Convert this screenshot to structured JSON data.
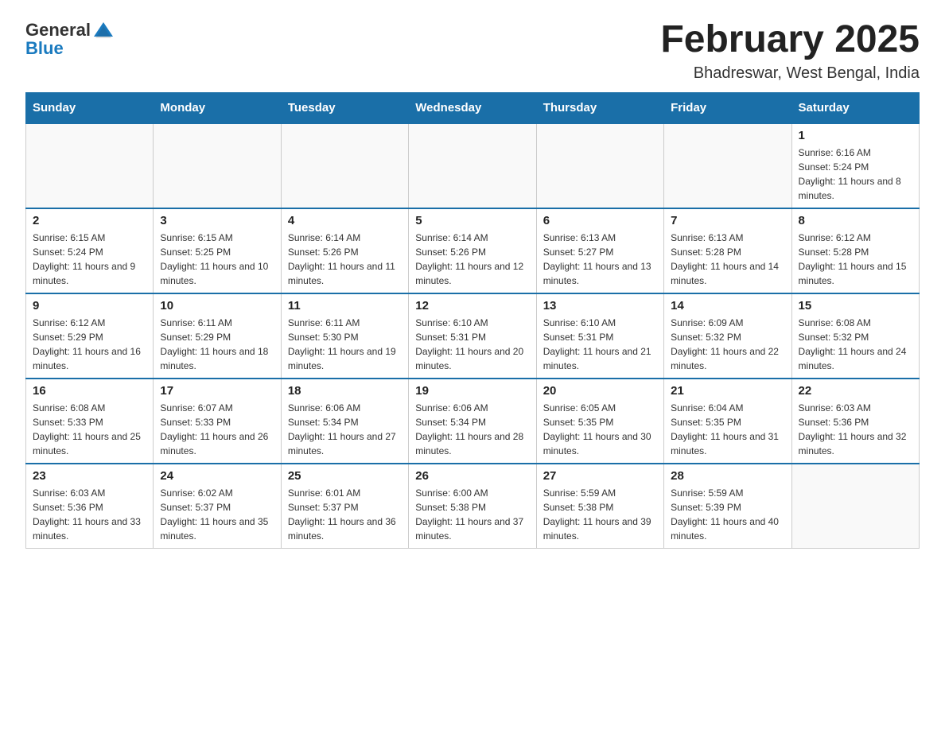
{
  "header": {
    "logo_general": "General",
    "logo_blue": "Blue",
    "title": "February 2025",
    "subtitle": "Bhadreswar, West Bengal, India"
  },
  "days_of_week": [
    "Sunday",
    "Monday",
    "Tuesday",
    "Wednesday",
    "Thursday",
    "Friday",
    "Saturday"
  ],
  "weeks": [
    {
      "days": [
        {
          "date": "",
          "info": ""
        },
        {
          "date": "",
          "info": ""
        },
        {
          "date": "",
          "info": ""
        },
        {
          "date": "",
          "info": ""
        },
        {
          "date": "",
          "info": ""
        },
        {
          "date": "",
          "info": ""
        },
        {
          "date": "1",
          "info": "Sunrise: 6:16 AM\nSunset: 5:24 PM\nDaylight: 11 hours and 8 minutes."
        }
      ]
    },
    {
      "days": [
        {
          "date": "2",
          "info": "Sunrise: 6:15 AM\nSunset: 5:24 PM\nDaylight: 11 hours and 9 minutes."
        },
        {
          "date": "3",
          "info": "Sunrise: 6:15 AM\nSunset: 5:25 PM\nDaylight: 11 hours and 10 minutes."
        },
        {
          "date": "4",
          "info": "Sunrise: 6:14 AM\nSunset: 5:26 PM\nDaylight: 11 hours and 11 minutes."
        },
        {
          "date": "5",
          "info": "Sunrise: 6:14 AM\nSunset: 5:26 PM\nDaylight: 11 hours and 12 minutes."
        },
        {
          "date": "6",
          "info": "Sunrise: 6:13 AM\nSunset: 5:27 PM\nDaylight: 11 hours and 13 minutes."
        },
        {
          "date": "7",
          "info": "Sunrise: 6:13 AM\nSunset: 5:28 PM\nDaylight: 11 hours and 14 minutes."
        },
        {
          "date": "8",
          "info": "Sunrise: 6:12 AM\nSunset: 5:28 PM\nDaylight: 11 hours and 15 minutes."
        }
      ]
    },
    {
      "days": [
        {
          "date": "9",
          "info": "Sunrise: 6:12 AM\nSunset: 5:29 PM\nDaylight: 11 hours and 16 minutes."
        },
        {
          "date": "10",
          "info": "Sunrise: 6:11 AM\nSunset: 5:29 PM\nDaylight: 11 hours and 18 minutes."
        },
        {
          "date": "11",
          "info": "Sunrise: 6:11 AM\nSunset: 5:30 PM\nDaylight: 11 hours and 19 minutes."
        },
        {
          "date": "12",
          "info": "Sunrise: 6:10 AM\nSunset: 5:31 PM\nDaylight: 11 hours and 20 minutes."
        },
        {
          "date": "13",
          "info": "Sunrise: 6:10 AM\nSunset: 5:31 PM\nDaylight: 11 hours and 21 minutes."
        },
        {
          "date": "14",
          "info": "Sunrise: 6:09 AM\nSunset: 5:32 PM\nDaylight: 11 hours and 22 minutes."
        },
        {
          "date": "15",
          "info": "Sunrise: 6:08 AM\nSunset: 5:32 PM\nDaylight: 11 hours and 24 minutes."
        }
      ]
    },
    {
      "days": [
        {
          "date": "16",
          "info": "Sunrise: 6:08 AM\nSunset: 5:33 PM\nDaylight: 11 hours and 25 minutes."
        },
        {
          "date": "17",
          "info": "Sunrise: 6:07 AM\nSunset: 5:33 PM\nDaylight: 11 hours and 26 minutes."
        },
        {
          "date": "18",
          "info": "Sunrise: 6:06 AM\nSunset: 5:34 PM\nDaylight: 11 hours and 27 minutes."
        },
        {
          "date": "19",
          "info": "Sunrise: 6:06 AM\nSunset: 5:34 PM\nDaylight: 11 hours and 28 minutes."
        },
        {
          "date": "20",
          "info": "Sunrise: 6:05 AM\nSunset: 5:35 PM\nDaylight: 11 hours and 30 minutes."
        },
        {
          "date": "21",
          "info": "Sunrise: 6:04 AM\nSunset: 5:35 PM\nDaylight: 11 hours and 31 minutes."
        },
        {
          "date": "22",
          "info": "Sunrise: 6:03 AM\nSunset: 5:36 PM\nDaylight: 11 hours and 32 minutes."
        }
      ]
    },
    {
      "days": [
        {
          "date": "23",
          "info": "Sunrise: 6:03 AM\nSunset: 5:36 PM\nDaylight: 11 hours and 33 minutes."
        },
        {
          "date": "24",
          "info": "Sunrise: 6:02 AM\nSunset: 5:37 PM\nDaylight: 11 hours and 35 minutes."
        },
        {
          "date": "25",
          "info": "Sunrise: 6:01 AM\nSunset: 5:37 PM\nDaylight: 11 hours and 36 minutes."
        },
        {
          "date": "26",
          "info": "Sunrise: 6:00 AM\nSunset: 5:38 PM\nDaylight: 11 hours and 37 minutes."
        },
        {
          "date": "27",
          "info": "Sunrise: 5:59 AM\nSunset: 5:38 PM\nDaylight: 11 hours and 39 minutes."
        },
        {
          "date": "28",
          "info": "Sunrise: 5:59 AM\nSunset: 5:39 PM\nDaylight: 11 hours and 40 minutes."
        },
        {
          "date": "",
          "info": ""
        }
      ]
    }
  ]
}
